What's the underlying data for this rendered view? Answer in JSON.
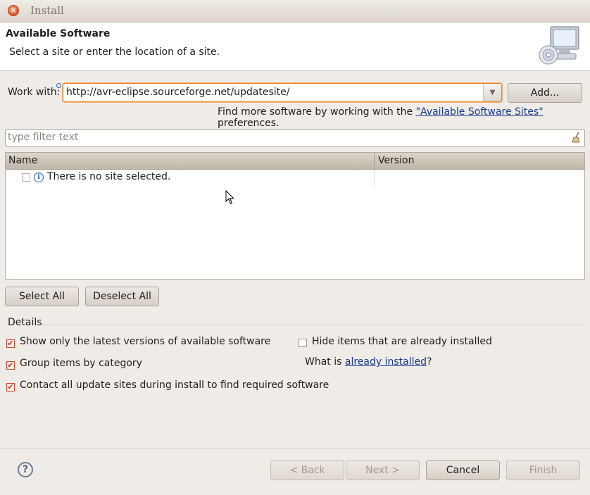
{
  "window": {
    "title": "Install"
  },
  "header": {
    "title": "Available Software",
    "description": "Select a site or enter the location of a site."
  },
  "work_with": {
    "label": "Work with:",
    "value": "http://avr-eclipse.sourceforge.net/updatesite/",
    "add_label": "Add...",
    "find_more_prefix": "Find more software by working with the ",
    "find_more_link": "\"Available Software Sites\"",
    "find_more_suffix": " preferences."
  },
  "filter": {
    "placeholder": "type filter text"
  },
  "table": {
    "columns": [
      "Name",
      "Version"
    ],
    "rows": [
      {
        "name": "There is no site selected.",
        "version": ""
      }
    ]
  },
  "buttons": {
    "select_all": "Select All",
    "deselect_all": "Deselect All",
    "back": "< Back",
    "next": "Next >",
    "cancel": "Cancel",
    "finish": "Finish"
  },
  "details": {
    "label": "Details",
    "options": [
      {
        "label": "Show only the latest versions of available software",
        "checked": true
      },
      {
        "label": "Hide items that are already installed",
        "checked": false
      },
      {
        "label": "Group items by category",
        "checked": true
      },
      {
        "label": "Contact all update sites during install to find required software",
        "checked": true
      }
    ],
    "what_is_prefix": "What is ",
    "what_is_link": "already installed",
    "what_is_suffix": "?"
  },
  "colors": {
    "link": "#1b3c8c",
    "focus_border": "#e8801f",
    "header_bg": "#ffffff"
  }
}
